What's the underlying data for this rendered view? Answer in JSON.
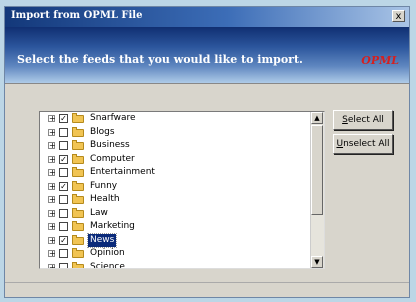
{
  "window": {
    "title": "Import from OPML File",
    "close_glyph": "x"
  },
  "header": {
    "instruction": "Select the feeds that you would like to import.",
    "logo": "OPML"
  },
  "feeds": [
    {
      "label": "Snarfware",
      "checked": true,
      "selected": false
    },
    {
      "label": "Blogs",
      "checked": false,
      "selected": false
    },
    {
      "label": "Business",
      "checked": false,
      "selected": false
    },
    {
      "label": "Computer",
      "checked": true,
      "selected": false
    },
    {
      "label": "Entertainment",
      "checked": false,
      "selected": false
    },
    {
      "label": "Funny",
      "checked": true,
      "selected": false
    },
    {
      "label": "Health",
      "checked": false,
      "selected": false
    },
    {
      "label": "Law",
      "checked": false,
      "selected": false
    },
    {
      "label": "Marketing",
      "checked": false,
      "selected": false
    },
    {
      "label": "News",
      "checked": true,
      "selected": true
    },
    {
      "label": "Opinion",
      "checked": false,
      "selected": false
    },
    {
      "label": "Science",
      "checked": false,
      "selected": false
    }
  ],
  "buttons": {
    "select_all": {
      "accel": "S",
      "rest": "elect All"
    },
    "unselect_all": {
      "accel": "U",
      "rest": "nselect All"
    }
  },
  "icons": {
    "expand": "plus-box-icon",
    "check": "checkbox-icon",
    "folder": "folder-icon",
    "scroll_up": "scroll-up-arrow-icon",
    "scroll_down": "scroll-down-arrow-icon"
  }
}
